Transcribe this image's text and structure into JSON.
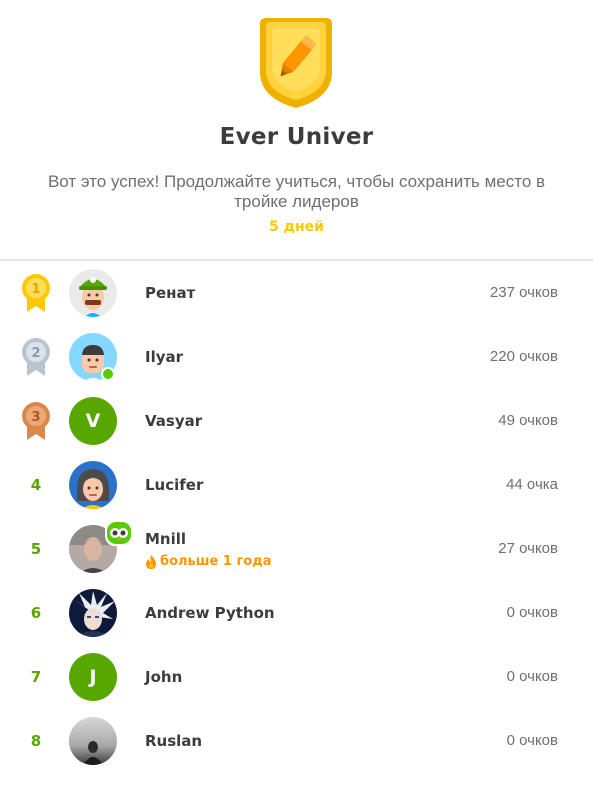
{
  "header": {
    "league_icon": "league-badge-icon",
    "title": "Ever Univer",
    "subtitle": "Вот это успех! Продолжайте учиться, чтобы сохранить место в тройке лидеров",
    "days_left": "5 дней"
  },
  "colors": {
    "rank_green": "#58a700",
    "gold": "#ffc800",
    "streak_orange": "#ff9600",
    "text_dark": "#3c3c3c",
    "text_gray": "#6f6f6f"
  },
  "leaderboard": [
    {
      "rank": "1",
      "name": "Ренат",
      "points": "237 очков",
      "avatar": "character-avatar-green-cap"
    },
    {
      "rank": "2",
      "name": "Ilyar",
      "points": "220 очков",
      "avatar": "character-avatar-boy",
      "online": true
    },
    {
      "rank": "3",
      "name": "Vasyar",
      "points": "49 очков",
      "avatar_letter": "V"
    },
    {
      "rank": "4",
      "name": "Lucifer",
      "points": "44 очка",
      "avatar": "character-avatar-dark-hair"
    },
    {
      "rank": "5",
      "name": "Mnill",
      "points": "27 очков",
      "streak": "больше 1 года",
      "badge": "duo-owl-icon"
    },
    {
      "rank": "6",
      "name": "Andrew Python",
      "points": "0 очков",
      "avatar": "anime-photo-avatar"
    },
    {
      "rank": "7",
      "name": "John",
      "points": "0 очков",
      "avatar_letter": "J"
    },
    {
      "rank": "8",
      "name": "Ruslan",
      "points": "0 очков",
      "avatar": "photo-avatar-gray"
    }
  ]
}
